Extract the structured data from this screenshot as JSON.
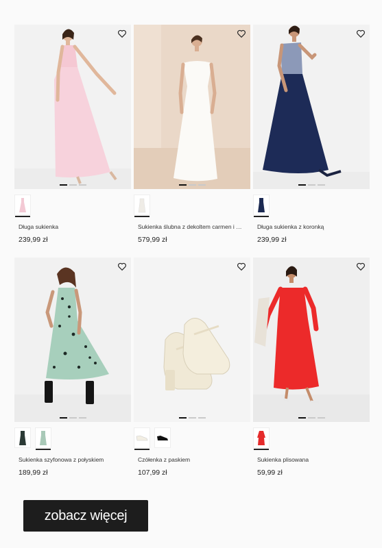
{
  "products": [
    {
      "name": "Długa sukienka",
      "price": "239,99 zł",
      "swatch_colors": [
        "#f3c9d4"
      ],
      "bg": "#f2f2f2",
      "dress": "#f7d2dc"
    },
    {
      "name": "Sukienka ślubna z dekoltem carmen i koronką",
      "price": "579,99 zł",
      "swatch_colors": [
        "#f1efea"
      ],
      "bg": "#ead8c8",
      "dress": "#fbfaf7"
    },
    {
      "name": "Długa sukienka z koronką",
      "price": "239,99 zł",
      "swatch_colors": [
        "#1c2a52"
      ],
      "bg": "#f2f2f2",
      "dress": "#1d2b57"
    },
    {
      "name": "Sukienka szyfonowa z połyskiem",
      "price": "189,99 zł",
      "swatch_colors": [
        "#2b3a35",
        "#a9c9b8"
      ],
      "bg": "#f1f1f1",
      "dress": "#a7cfbc"
    },
    {
      "name": "Czółenka z paskiem",
      "price": "107,99 zł",
      "swatch_colors": [
        "#f3efe4",
        "#111111"
      ],
      "bg": "#f4f4f4",
      "dress": "#f2ecdc"
    },
    {
      "name": "Sukienka plisowana",
      "price": "59,99 zł",
      "swatch_colors": [
        "#e52b2b"
      ],
      "bg": "#efefef",
      "dress": "#ec2a2a"
    }
  ],
  "more_button": {
    "label": "zobacz więcej"
  },
  "colors": {
    "accent": "#1d1d1d",
    "dot_active": "#111111",
    "dot_inactive": "#c9c9c9"
  }
}
